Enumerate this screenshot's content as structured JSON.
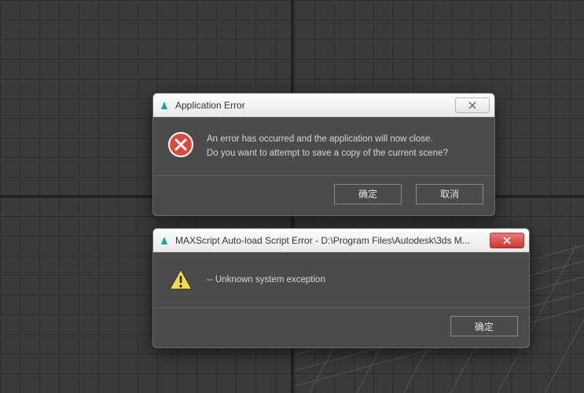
{
  "dialog1": {
    "title": "Application Error",
    "message_line1": "An error has occurred and the application will now close.",
    "message_line2": "Do you want to attempt to save a copy of the current scene?",
    "ok_label": "确定",
    "cancel_label": "取消"
  },
  "dialog2": {
    "title": "MAXScript Auto-load Script Error - D:\\Program Files\\Autodesk\\3ds M...",
    "message": "-- Unknown system exception",
    "ok_label": "确定"
  }
}
